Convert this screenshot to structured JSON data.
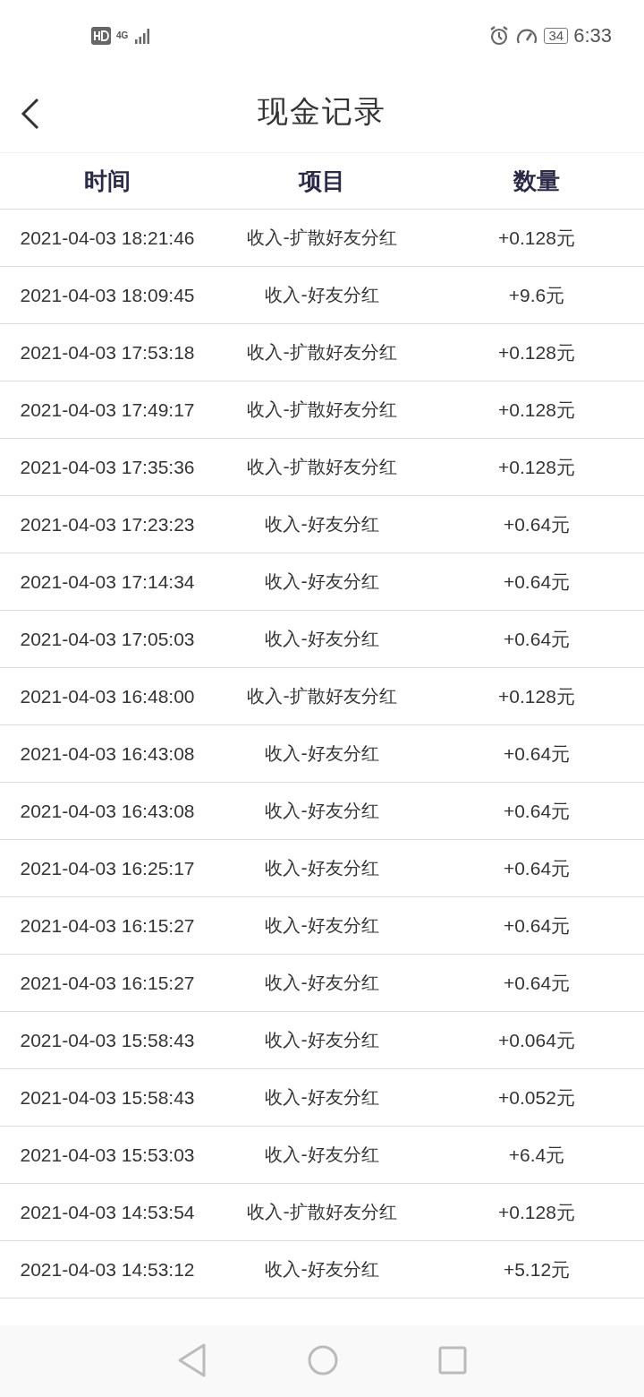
{
  "status_bar": {
    "network": "4G",
    "battery": "34",
    "time": "6:33"
  },
  "header": {
    "title": "现金记录"
  },
  "table": {
    "columns": [
      "时间",
      "项目",
      "数量"
    ],
    "rows": [
      [
        "2021-04-03 18:21:46",
        "收入-扩散好友分红",
        "+0.128元"
      ],
      [
        "2021-04-03 18:09:45",
        "收入-好友分红",
        "+9.6元"
      ],
      [
        "2021-04-03 17:53:18",
        "收入-扩散好友分红",
        "+0.128元"
      ],
      [
        "2021-04-03 17:49:17",
        "收入-扩散好友分红",
        "+0.128元"
      ],
      [
        "2021-04-03 17:35:36",
        "收入-扩散好友分红",
        "+0.128元"
      ],
      [
        "2021-04-03 17:23:23",
        "收入-好友分红",
        "+0.64元"
      ],
      [
        "2021-04-03 17:14:34",
        "收入-好友分红",
        "+0.64元"
      ],
      [
        "2021-04-03 17:05:03",
        "收入-好友分红",
        "+0.64元"
      ],
      [
        "2021-04-03 16:48:00",
        "收入-扩散好友分红",
        "+0.128元"
      ],
      [
        "2021-04-03 16:43:08",
        "收入-好友分红",
        "+0.64元"
      ],
      [
        "2021-04-03 16:43:08",
        "收入-好友分红",
        "+0.64元"
      ],
      [
        "2021-04-03 16:25:17",
        "收入-好友分红",
        "+0.64元"
      ],
      [
        "2021-04-03 16:15:27",
        "收入-好友分红",
        "+0.64元"
      ],
      [
        "2021-04-03 16:15:27",
        "收入-好友分红",
        "+0.64元"
      ],
      [
        "2021-04-03 15:58:43",
        "收入-好友分红",
        "+0.064元"
      ],
      [
        "2021-04-03 15:58:43",
        "收入-好友分红",
        "+0.052元"
      ],
      [
        "2021-04-03 15:53:03",
        "收入-好友分红",
        "+6.4元"
      ],
      [
        "2021-04-03 14:53:54",
        "收入-扩散好友分红",
        "+0.128元"
      ],
      [
        "2021-04-03 14:53:12",
        "收入-好友分红",
        "+5.12元"
      ]
    ]
  }
}
